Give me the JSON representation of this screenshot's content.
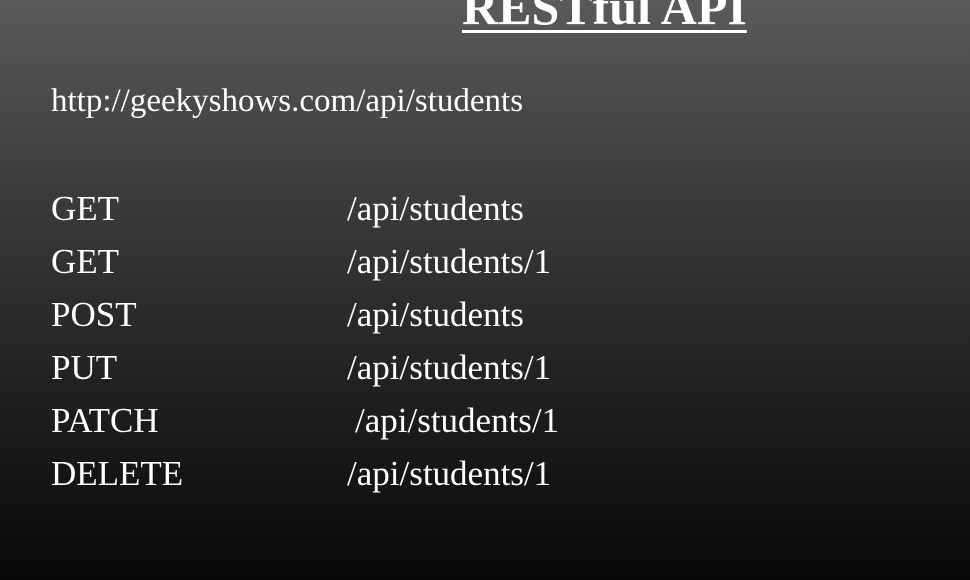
{
  "slide": {
    "title": "RESTful API",
    "url": "http://geekyshows.com/api/students",
    "routes": [
      {
        "method": "GET",
        "path": "/api/students"
      },
      {
        "method": "GET",
        "path": "/api/students/1"
      },
      {
        "method": "POST",
        "path": "/api/students"
      },
      {
        "method": "PUT",
        "path": "/api/students/1"
      },
      {
        "method": "PATCH",
        "path": "/api/students/1"
      },
      {
        "method": "DELETE",
        "path": "/api/students/1"
      }
    ]
  }
}
